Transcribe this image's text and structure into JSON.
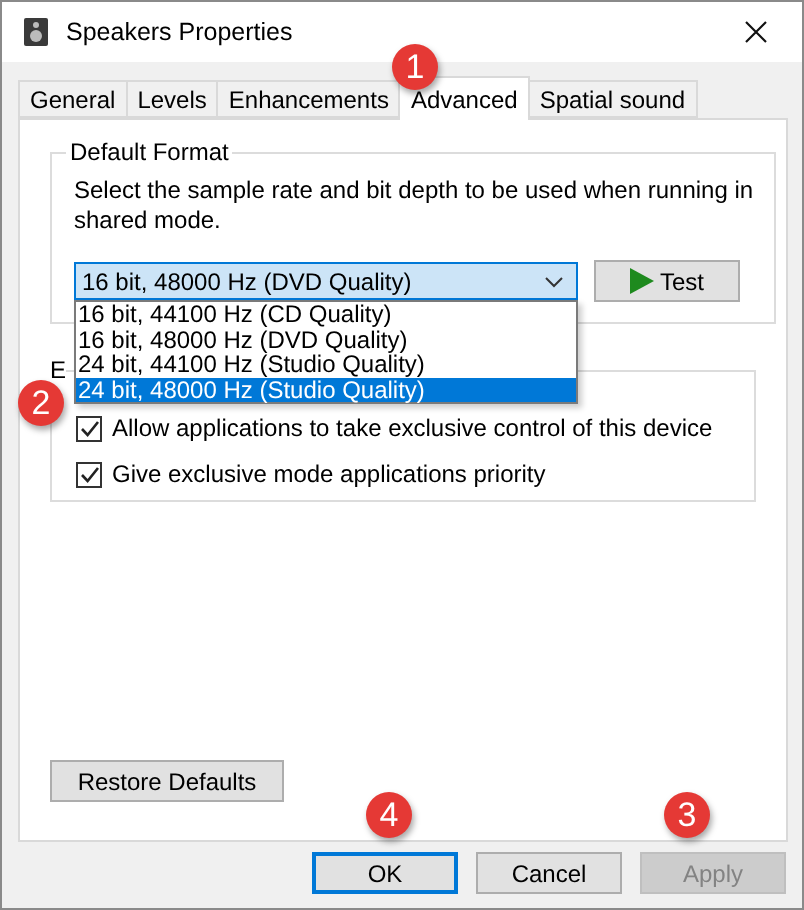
{
  "window": {
    "title": "Speakers Properties"
  },
  "tabs": [
    {
      "label": "General",
      "selected": false
    },
    {
      "label": "Levels",
      "selected": false
    },
    {
      "label": "Enhancements",
      "selected": false
    },
    {
      "label": "Advanced",
      "selected": true
    },
    {
      "label": "Spatial sound",
      "selected": false
    }
  ],
  "default_format": {
    "title": "Default Format",
    "description": "Select the sample rate and bit depth to be used when running in shared mode.",
    "combo": {
      "value": "16 bit, 48000 Hz (DVD Quality)",
      "expanded": true
    },
    "options": [
      {
        "label": "16 bit, 44100 Hz (CD Quality)",
        "selected": false
      },
      {
        "label": "16 bit, 48000 Hz (DVD Quality)",
        "selected": false
      },
      {
        "label": "24 bit, 44100 Hz (Studio Quality)",
        "selected": false
      },
      {
        "label": "24 bit, 48000 Hz (Studio Quality)",
        "selected": true
      }
    ],
    "test_button": "Test"
  },
  "exclusive_mode": {
    "title": "E",
    "options": [
      {
        "label": "Allow applications to take exclusive control of this device",
        "checked": true
      },
      {
        "label": "Give exclusive mode applications priority",
        "checked": true
      }
    ]
  },
  "restore_button": "Restore Defaults",
  "buttons": [
    {
      "label": "OK",
      "focused": true,
      "disabled": false
    },
    {
      "label": "Cancel",
      "focused": false,
      "disabled": false
    },
    {
      "label": "Apply",
      "focused": false,
      "disabled": true
    }
  ],
  "badges": [
    "1",
    "2",
    "3",
    "4"
  ]
}
